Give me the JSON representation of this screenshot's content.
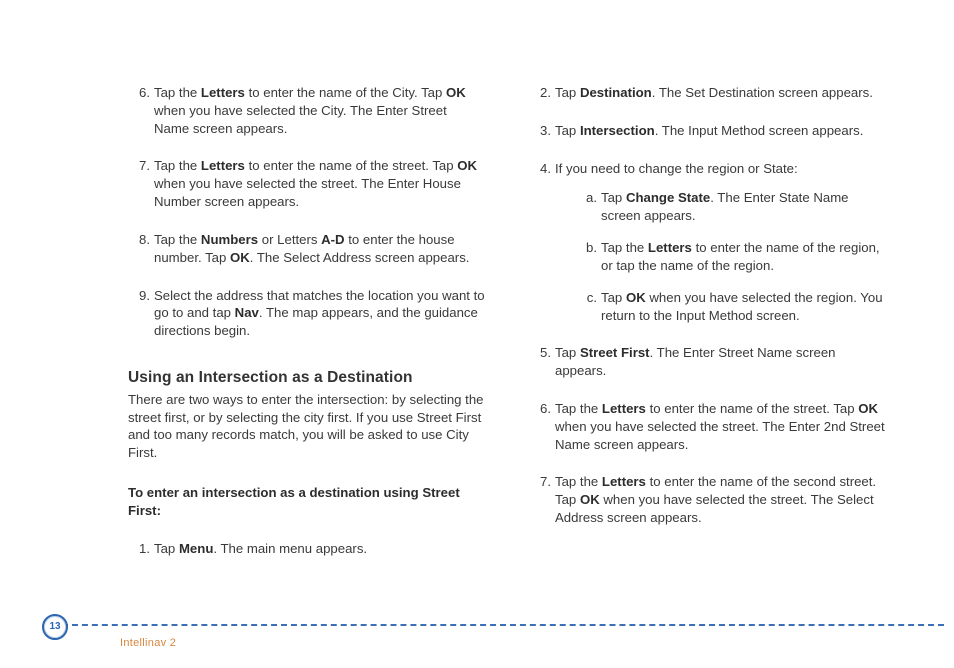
{
  "left": {
    "items": [
      {
        "n": "6.",
        "parts": [
          "Tap the ",
          {
            "b": "Letters"
          },
          " to enter the name of the City. Tap ",
          {
            "b": "OK"
          },
          " when you have selected the City. The Enter Street Name screen appears."
        ]
      },
      {
        "n": "7.",
        "parts": [
          "Tap the ",
          {
            "b": "Letters"
          },
          " to enter the name of the street. Tap ",
          {
            "b": "OK"
          },
          " when you have selected the street. The Enter House Number screen appears."
        ]
      },
      {
        "n": "8.",
        "parts": [
          "Tap the ",
          {
            "b": "Numbers"
          },
          " or Letters ",
          {
            "b": "A-D"
          },
          " to enter the house number. Tap ",
          {
            "b": "OK"
          },
          ". The Select Address screen appears."
        ]
      },
      {
        "n": "9.",
        "parts": [
          "Select the address that matches the location you want to go to and tap ",
          {
            "b": "Nav"
          },
          ". The map appears, and the guidance directions begin."
        ]
      }
    ],
    "section_title": "Using an Intersection as a Destination",
    "section_lead": "There are two ways to enter the intersection:  by selecting the street first, or by selecting the city first. If you use Street First and too many records match, you will be asked to use City First.",
    "subhead_parts": [
      {
        "b": "To enter an intersection as a destination using Street First:"
      }
    ],
    "sub_items": [
      {
        "n": "1.",
        "parts": [
          "Tap ",
          {
            "b": "Menu"
          },
          ". The main menu appears."
        ]
      }
    ]
  },
  "right": {
    "items": [
      {
        "n": "2.",
        "parts": [
          "Tap ",
          {
            "b": "Destination"
          },
          ". The Set Destination screen appears."
        ]
      },
      {
        "n": "3.",
        "parts": [
          "Tap ",
          {
            "b": "Intersection"
          },
          ". The Input Method screen appears."
        ]
      },
      {
        "n": "4.",
        "parts": [
          "If you need to change the region or State:"
        ],
        "alpha": [
          {
            "n": "a.",
            "parts": [
              "Tap ",
              {
                "b": "Change State"
              },
              ". The Enter State Name screen appears."
            ]
          },
          {
            "n": "b.",
            "parts": [
              "Tap the ",
              {
                "b": "Letters"
              },
              " to enter the name of the region, or tap the name of the region."
            ]
          },
          {
            "n": "c.",
            "parts": [
              "Tap ",
              {
                "b": "OK"
              },
              " when you have selected the region. You return to the Input Method screen."
            ]
          }
        ]
      },
      {
        "n": "5.",
        "parts": [
          "Tap ",
          {
            "b": "Street First"
          },
          ". The Enter Street Name screen appears."
        ]
      },
      {
        "n": "6.",
        "parts": [
          "Tap the ",
          {
            "b": "Letters"
          },
          " to enter the name of the street. Tap ",
          {
            "b": "OK"
          },
          " when you have selected the street. The Enter 2nd Street Name screen appears."
        ]
      },
      {
        "n": "7.",
        "parts": [
          "Tap the ",
          {
            "b": "Letters"
          },
          " to enter the name of the second street. Tap ",
          {
            "b": "OK"
          },
          " when you have selected the street. The Select Address screen appears."
        ]
      }
    ]
  },
  "footer": {
    "page_number": "13",
    "product": "Intellinav 2"
  }
}
